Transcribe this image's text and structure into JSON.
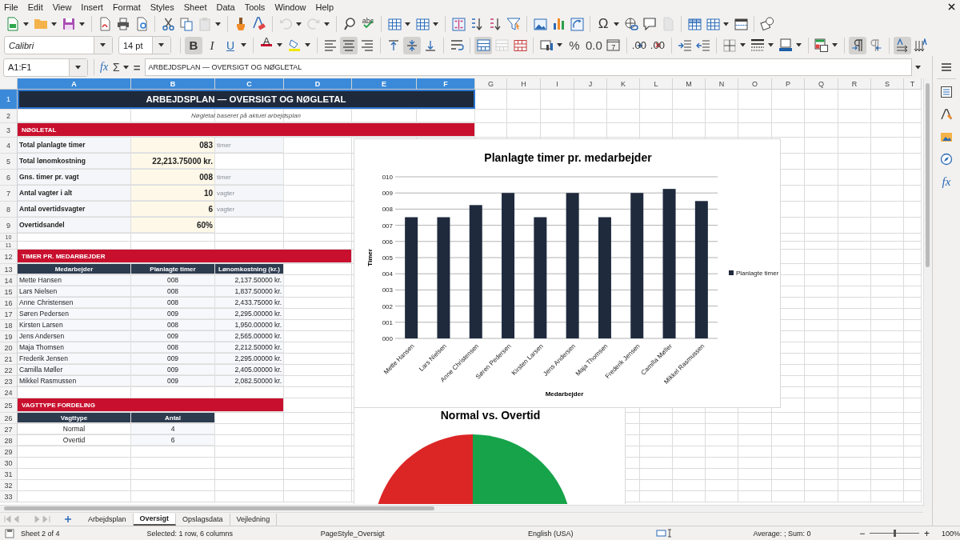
{
  "menu": [
    "File",
    "Edit",
    "View",
    "Insert",
    "Format",
    "Styles",
    "Sheet",
    "Data",
    "Tools",
    "Window",
    "Help"
  ],
  "standard_toolbar": [
    {
      "kind": "new-spreadsheet",
      "dropdown": true,
      "disabled": false,
      "separator": false
    },
    {
      "kind": "folder",
      "dropdown": true,
      "disabled": false,
      "separator": false
    },
    {
      "kind": "save",
      "dropdown": true,
      "disabled": false,
      "separator": false
    },
    {
      "kind": "pdf-export",
      "dropdown": false,
      "disabled": false,
      "separator": true
    },
    {
      "kind": "printer",
      "dropdown": false,
      "disabled": false,
      "separator": false
    },
    {
      "kind": "print-preview",
      "dropdown": false,
      "disabled": false,
      "separator": false
    },
    {
      "kind": "scissors",
      "dropdown": false,
      "disabled": false,
      "separator": true
    },
    {
      "kind": "copy",
      "dropdown": false,
      "disabled": false,
      "separator": false
    },
    {
      "kind": "clipboard",
      "dropdown": true,
      "disabled": true,
      "separator": false
    },
    {
      "kind": "paintbrush",
      "dropdown": false,
      "disabled": false,
      "separator": true
    },
    {
      "kind": "clear-formatting",
      "dropdown": false,
      "disabled": false,
      "separator": false
    },
    {
      "kind": "undo",
      "dropdown": true,
      "disabled": true,
      "separator": true
    },
    {
      "kind": "redo",
      "dropdown": true,
      "disabled": true,
      "separator": false
    },
    {
      "kind": "find-replace",
      "dropdown": false,
      "disabled": false,
      "separator": true
    },
    {
      "kind": "spellcheck",
      "label": "abc",
      "dropdown": false,
      "disabled": false,
      "separator": false
    },
    {
      "kind": "table-rows",
      "dropdown": true,
      "disabled": false,
      "separator": true
    },
    {
      "kind": "table-columns",
      "dropdown": true,
      "disabled": false,
      "separator": false
    },
    {
      "kind": "sort",
      "dropdown": false,
      "disabled": false,
      "separator": true
    },
    {
      "kind": "sort-ascending",
      "dropdown": false,
      "disabled": false,
      "separator": false
    },
    {
      "kind": "sort-descending",
      "dropdown": false,
      "disabled": false,
      "separator": false
    },
    {
      "kind": "funnel",
      "dropdown": false,
      "disabled": false,
      "separator": false
    },
    {
      "kind": "image",
      "dropdown": false,
      "disabled": false,
      "separator": true
    },
    {
      "kind": "bar-chart",
      "dropdown": false,
      "disabled": false,
      "separator": false
    },
    {
      "kind": "pivot-table",
      "dropdown": false,
      "disabled": false,
      "separator": false
    },
    {
      "kind": "special-character",
      "label": "Ω",
      "dropdown": true,
      "disabled": false,
      "separator": true
    },
    {
      "kind": "hyperlink",
      "dropdown": false,
      "disabled": false,
      "separator": false
    },
    {
      "kind": "comment",
      "dropdown": false,
      "disabled": false,
      "separator": false
    },
    {
      "kind": "page",
      "dropdown": false,
      "disabled": true,
      "separator": false
    },
    {
      "kind": "print-area",
      "dropdown": false,
      "disabled": false,
      "separator": true
    },
    {
      "kind": "freeze-grid",
      "dropdown": true,
      "disabled": false,
      "separator": false
    },
    {
      "kind": "split-window",
      "dropdown": false,
      "disabled": false,
      "separator": false
    },
    {
      "kind": "shapes",
      "dropdown": false,
      "disabled": false,
      "separator": true
    }
  ],
  "font_name": "Calibri",
  "font_size": "14 pt",
  "format_toolbar": [
    {
      "kind": "bold",
      "label": "B",
      "pressed": true,
      "dropdown": false,
      "disabled": false,
      "separator": true
    },
    {
      "kind": "italic",
      "label": "I",
      "pressed": false,
      "dropdown": false,
      "disabled": false,
      "separator": false
    },
    {
      "kind": "underline",
      "label": "U",
      "pressed": false,
      "dropdown": true,
      "disabled": false,
      "separator": false
    },
    {
      "kind": "font-color",
      "label": "A",
      "pressed": false,
      "dropdown": true,
      "disabled": false,
      "separator": true
    },
    {
      "kind": "highlight",
      "pressed": false,
      "dropdown": true,
      "disabled": false,
      "separator": false
    },
    {
      "kind": "align-left",
      "pressed": false,
      "dropdown": false,
      "disabled": false,
      "separator": true
    },
    {
      "kind": "align-center",
      "pressed": true,
      "dropdown": false,
      "disabled": false,
      "separator": false
    },
    {
      "kind": "align-right",
      "pressed": false,
      "dropdown": false,
      "disabled": false,
      "separator": false
    },
    {
      "kind": "align-top",
      "pressed": false,
      "dropdown": false,
      "disabled": false,
      "separator": true
    },
    {
      "kind": "align-middle",
      "pressed": true,
      "dropdown": false,
      "disabled": false,
      "separator": false
    },
    {
      "kind": "align-bottom",
      "pressed": false,
      "dropdown": false,
      "disabled": false,
      "separator": false
    },
    {
      "kind": "wrap-text",
      "pressed": false,
      "dropdown": false,
      "disabled": false,
      "separator": true
    },
    {
      "kind": "merge-center",
      "pressed": true,
      "dropdown": false,
      "disabled": false,
      "separator": true
    },
    {
      "kind": "merge-cells",
      "pressed": false,
      "dropdown": false,
      "disabled": true,
      "separator": false
    },
    {
      "kind": "unmerge",
      "pressed": false,
      "dropdown": false,
      "disabled": false,
      "separator": false
    },
    {
      "kind": "number-format",
      "pressed": false,
      "dropdown": true,
      "disabled": false,
      "separator": true
    },
    {
      "kind": "percent",
      "label": "%",
      "pressed": false,
      "dropdown": false,
      "disabled": false,
      "separator": false
    },
    {
      "kind": "decimal",
      "label": "0.0",
      "pressed": false,
      "dropdown": false,
      "disabled": false,
      "separator": false
    },
    {
      "kind": "calendar",
      "label": "7",
      "pressed": false,
      "dropdown": false,
      "disabled": false,
      "separator": false
    },
    {
      "kind": "add-decimal",
      "label": ".00",
      "pressed": false,
      "dropdown": false,
      "disabled": false,
      "separator": true
    },
    {
      "kind": "delete-decimal",
      "label": ".00",
      "pressed": false,
      "dropdown": false,
      "disabled": false,
      "separator": false
    },
    {
      "kind": "indent-increase",
      "pressed": false,
      "dropdown": false,
      "disabled": false,
      "separator": true
    },
    {
      "kind": "indent-decrease",
      "pressed": false,
      "dropdown": false,
      "disabled": false,
      "separator": false
    },
    {
      "kind": "borders",
      "pressed": false,
      "dropdown": true,
      "disabled": false,
      "separator": true
    },
    {
      "kind": "border-style",
      "pressed": false,
      "dropdown": true,
      "disabled": false,
      "separator": false
    },
    {
      "kind": "border-color",
      "pressed": false,
      "dropdown": true,
      "disabled": false,
      "separator": false
    },
    {
      "kind": "conditional-format",
      "pressed": false,
      "dropdown": true,
      "disabled": false,
      "separator": true
    },
    {
      "kind": "paragraph-ltr",
      "pressed": true,
      "dropdown": false,
      "disabled": false,
      "separator": true
    },
    {
      "kind": "paragraph-rtl",
      "pressed": false,
      "dropdown": false,
      "disabled": false,
      "separator": false
    },
    {
      "kind": "text-ltr",
      "pressed": true,
      "dropdown": false,
      "disabled": false,
      "separator": true
    },
    {
      "kind": "text-vertical",
      "pressed": false,
      "dropdown": false,
      "disabled": false,
      "separator": false
    }
  ],
  "formula_bar": {
    "name_box": "A1:F1",
    "function_label": "fx",
    "sum_label": "Σ",
    "equals_label": "=",
    "formula": "ARBEJDSPLAN — OVERSIGT OG NØGLETAL"
  },
  "sheet": {
    "columns": [
      {
        "label": "A",
        "selected": true
      },
      {
        "label": "B",
        "selected": true
      },
      {
        "label": "C",
        "selected": true
      },
      {
        "label": "D",
        "selected": true
      },
      {
        "label": "E",
        "selected": true
      },
      {
        "label": "F",
        "selected": true
      },
      {
        "label": "G",
        "selected": false
      },
      {
        "label": "H",
        "selected": false
      },
      {
        "label": "I",
        "selected": false
      },
      {
        "label": "J",
        "selected": false
      },
      {
        "label": "K",
        "selected": false
      },
      {
        "label": "L",
        "selected": false
      },
      {
        "label": "M",
        "selected": false
      },
      {
        "label": "N",
        "selected": false
      },
      {
        "label": "O",
        "selected": false
      },
      {
        "label": "P",
        "selected": false
      },
      {
        "label": "Q",
        "selected": false
      },
      {
        "label": "R",
        "selected": false
      },
      {
        "label": "S",
        "selected": false
      },
      {
        "label": "T",
        "selected": false
      }
    ],
    "rows": [
      {
        "num": "1",
        "selected": true,
        "kind": "title",
        "cells": [
          {
            "kind": "title",
            "text": "ARBEJDSPLAN — OVERSIGT OG NØGLETAL"
          },
          {
            "kind": "fill"
          },
          {
            "kind": "fill"
          },
          {
            "kind": "fill"
          },
          {
            "kind": "fill"
          },
          {
            "kind": "fill"
          }
        ]
      },
      {
        "num": "2",
        "selected": false,
        "kind": "subtitle",
        "cells": [
          {
            "kind": "subtitle",
            "text": "Nøgletal baseret på aktuel arbejdsplan"
          },
          {
            "kind": "fill"
          },
          {
            "kind": "fill"
          },
          {
            "kind": "fill"
          },
          {
            "kind": "fill"
          },
          {
            "kind": "fill"
          }
        ]
      },
      {
        "num": "3",
        "selected": false,
        "kind": "section",
        "cells": [
          {
            "kind": "section",
            "text": "NØGLETAL"
          },
          {
            "kind": "fill"
          },
          {
            "kind": "fill"
          },
          {
            "kind": "fill"
          },
          {
            "kind": "fill"
          },
          {
            "kind": "fill"
          }
        ]
      },
      {
        "num": "4",
        "selected": false,
        "kind": "kpi",
        "cells": [
          {
            "kind": "kpi-label",
            "text": "Total planlagte timer"
          },
          {
            "kind": "kpi-value",
            "text": "083"
          },
          {
            "kind": "unit",
            "text": "timer"
          }
        ]
      },
      {
        "num": "5",
        "selected": false,
        "kind": "kpi",
        "cells": [
          {
            "kind": "kpi-label",
            "text": "Total lønomkostning"
          },
          {
            "kind": "kpi-value",
            "text": "22,213.75000 kr."
          }
        ]
      },
      {
        "num": "6",
        "selected": false,
        "kind": "kpi",
        "cells": [
          {
            "kind": "kpi-label",
            "text": "Gns. timer pr. vagt"
          },
          {
            "kind": "kpi-value",
            "text": "008"
          },
          {
            "kind": "unit",
            "text": "timer"
          }
        ]
      },
      {
        "num": "7",
        "selected": false,
        "kind": "kpi",
        "cells": [
          {
            "kind": "kpi-label",
            "text": "Antal vagter i alt"
          },
          {
            "kind": "kpi-value",
            "text": "10"
          },
          {
            "kind": "unit",
            "text": "vagter"
          }
        ]
      },
      {
        "num": "8",
        "selected": false,
        "kind": "kpi",
        "cells": [
          {
            "kind": "kpi-label",
            "text": "Antal overtidsvagter"
          },
          {
            "kind": "kpi-value",
            "text": "6"
          },
          {
            "kind": "unit",
            "text": "vagter"
          }
        ]
      },
      {
        "num": "9",
        "selected": false,
        "kind": "kpi",
        "cells": [
          {
            "kind": "kpi-label",
            "text": "Overtidsandel"
          },
          {
            "kind": "kpi-value",
            "text": "60%"
          }
        ]
      },
      {
        "num": "10",
        "selected": false,
        "kind": "spacer",
        "cells": []
      },
      {
        "num": "11",
        "selected": false,
        "kind": "spacer",
        "cells": []
      },
      {
        "num": "12",
        "selected": false,
        "kind": "section",
        "cells": [
          {
            "kind": "section",
            "text": "TIMER PR. MEDARBEJDER"
          },
          {
            "kind": "fill"
          },
          {
            "kind": "fill"
          },
          {
            "kind": "fill"
          }
        ]
      },
      {
        "num": "13",
        "selected": false,
        "kind": "header",
        "cells": [
          {
            "kind": "th",
            "text": "Medarbejder"
          },
          {
            "kind": "th",
            "text": "Planlagte timer"
          },
          {
            "kind": "th",
            "text": "Lønomkostning (kr.)"
          }
        ]
      },
      {
        "num": "14",
        "selected": false,
        "kind": "data",
        "cells": [
          {
            "kind": "name",
            "text": "Mette Hansen"
          },
          {
            "kind": "num",
            "text": "008"
          },
          {
            "kind": "money",
            "text": "2,137.50000 kr."
          }
        ]
      },
      {
        "num": "15",
        "selected": false,
        "kind": "data",
        "cells": [
          {
            "kind": "name",
            "text": "Lars Nielsen"
          },
          {
            "kind": "num",
            "text": "008"
          },
          {
            "kind": "money",
            "text": "1,837.50000 kr."
          }
        ]
      },
      {
        "num": "16",
        "selected": false,
        "kind": "data",
        "cells": [
          {
            "kind": "name",
            "text": "Anne Christensen"
          },
          {
            "kind": "num",
            "text": "008"
          },
          {
            "kind": "money",
            "text": "2,433.75000 kr."
          }
        ]
      },
      {
        "num": "17",
        "selected": false,
        "kind": "data",
        "cells": [
          {
            "kind": "name",
            "text": "Søren Pedersen"
          },
          {
            "kind": "num",
            "text": "009"
          },
          {
            "kind": "money",
            "text": "2,295.00000 kr."
          }
        ]
      },
      {
        "num": "18",
        "selected": false,
        "kind": "data",
        "cells": [
          {
            "kind": "name",
            "text": "Kirsten Larsen"
          },
          {
            "kind": "num",
            "text": "008"
          },
          {
            "kind": "money",
            "text": "1,950.00000 kr."
          }
        ]
      },
      {
        "num": "19",
        "selected": false,
        "kind": "data",
        "cells": [
          {
            "kind": "name",
            "text": "Jens Andersen"
          },
          {
            "kind": "num",
            "text": "009"
          },
          {
            "kind": "money",
            "text": "2,565.00000 kr."
          }
        ]
      },
      {
        "num": "20",
        "selected": false,
        "kind": "data",
        "cells": [
          {
            "kind": "name",
            "text": "Maja Thomsen"
          },
          {
            "kind": "num",
            "text": "008"
          },
          {
            "kind": "money",
            "text": "2,212.50000 kr."
          }
        ]
      },
      {
        "num": "21",
        "selected": false,
        "kind": "data",
        "cells": [
          {
            "kind": "name",
            "text": "Frederik Jensen"
          },
          {
            "kind": "num",
            "text": "009"
          },
          {
            "kind": "money",
            "text": "2,295.00000 kr."
          }
        ]
      },
      {
        "num": "22",
        "selected": false,
        "kind": "data",
        "cells": [
          {
            "kind": "name",
            "text": "Camilla Møller"
          },
          {
            "kind": "num",
            "text": "009"
          },
          {
            "kind": "money",
            "text": "2,405.00000 kr."
          }
        ]
      },
      {
        "num": "23",
        "selected": false,
        "kind": "data",
        "cells": [
          {
            "kind": "name",
            "text": "Mikkel Rasmussen"
          },
          {
            "kind": "num",
            "text": "009"
          },
          {
            "kind": "money",
            "text": "2,082.50000 kr."
          }
        ]
      },
      {
        "num": "24",
        "selected": false,
        "kind": "blank",
        "cells": []
      },
      {
        "num": "25",
        "selected": false,
        "kind": "section",
        "cells": [
          {
            "kind": "section",
            "text": "VAGTTYPE FORDELING"
          },
          {
            "kind": "fill"
          },
          {
            "kind": "fill"
          }
        ]
      },
      {
        "num": "26",
        "selected": false,
        "kind": "header",
        "cells": [
          {
            "kind": "th",
            "text": "Vagttype"
          },
          {
            "kind": "th",
            "text": "Antal"
          }
        ]
      },
      {
        "num": "27",
        "selected": false,
        "kind": "data",
        "cells": [
          {
            "kind": "center",
            "text": "Normal"
          },
          {
            "kind": "num",
            "text": "4"
          }
        ]
      },
      {
        "num": "28",
        "selected": false,
        "kind": "data",
        "cells": [
          {
            "kind": "center",
            "text": "Overtid"
          },
          {
            "kind": "num",
            "text": "6"
          }
        ]
      },
      {
        "num": "29",
        "selected": false,
        "kind": "blank",
        "cells": []
      },
      {
        "num": "30",
        "selected": false,
        "kind": "blank",
        "cells": []
      },
      {
        "num": "31",
        "selected": false,
        "kind": "blank",
        "cells": []
      },
      {
        "num": "32",
        "selected": false,
        "kind": "blank",
        "cells": []
      },
      {
        "num": "33",
        "selected": false,
        "kind": "blank",
        "cells": []
      }
    ]
  },
  "bar_chart": {
    "chart_data": {
      "type": "bar",
      "title": "Planlagte timer pr. medarbejder",
      "xlabel": "Medarbejder",
      "ylabel": "Timer",
      "grid": true,
      "categories": [
        "Mette Hansen",
        "Lars Nielsen",
        "Anne Christensen",
        "Søren Pedersen",
        "Kirsten Larsen",
        "Jens Andersen",
        "Maja Thomsen",
        "Frederik Jensen",
        "Camilla Møller",
        "Mikkel Rasmussen"
      ],
      "series": [
        {
          "name": "Planlagte timer",
          "color": "#1f2a3d",
          "values": [
            7.5,
            7.5,
            8.25,
            9,
            7.5,
            9,
            7.5,
            9,
            9.25,
            8.5
          ]
        }
      ],
      "ylim": [
        0,
        10
      ],
      "yticks": [
        {
          "value": 0,
          "label": "000"
        },
        {
          "value": 1,
          "label": "001"
        },
        {
          "value": 2,
          "label": "002"
        },
        {
          "value": 3,
          "label": "003"
        },
        {
          "value": 4,
          "label": "004"
        },
        {
          "value": 5,
          "label": "005"
        },
        {
          "value": 6,
          "label": "006"
        },
        {
          "value": 7,
          "label": "007"
        },
        {
          "value": 8,
          "label": "008"
        },
        {
          "value": 9,
          "label": "009"
        },
        {
          "value": 10,
          "label": "010"
        }
      ]
    }
  },
  "pie_chart": {
    "title": "Normal vs. Overtid"
  },
  "sheet_tabs": [
    {
      "label": "Arbejdsplan",
      "selected": false
    },
    {
      "label": "Oversigt",
      "selected": true
    },
    {
      "label": "Opslagsdata",
      "selected": false
    },
    {
      "label": "Vejledning",
      "selected": false
    }
  ],
  "status_bar": {
    "sheet": "Sheet 2 of 4",
    "selection": "Selected: 1 row, 6 columns",
    "page_style": "PageStyle_Oversigt",
    "language": "English (USA)",
    "summary": "Average: ; Sum: 0",
    "zoom": {
      "out_label": "−",
      "level": 0.5,
      "in_label": "+",
      "reading": "100%"
    }
  },
  "sidebar": {
    "function_label": "fx"
  }
}
